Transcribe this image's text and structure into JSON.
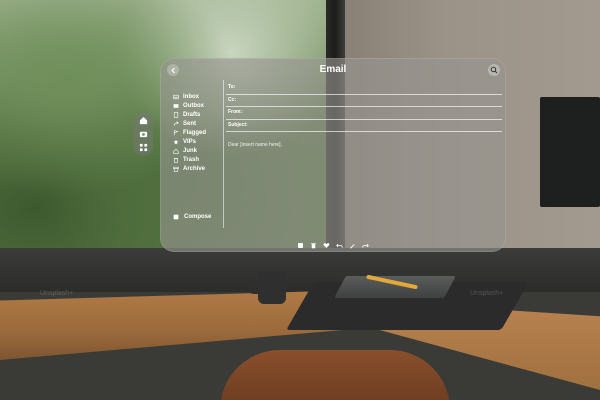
{
  "window": {
    "title": "Email"
  },
  "rail": {
    "icons": [
      "home-icon",
      "camera-icon",
      "grid-icon"
    ]
  },
  "sidebar": {
    "items": [
      {
        "label": "Inbox",
        "icon": "inbox-icon"
      },
      {
        "label": "Outbox",
        "icon": "outbox-icon"
      },
      {
        "label": "Drafts",
        "icon": "drafts-icon"
      },
      {
        "label": "Sent",
        "icon": "sent-icon"
      },
      {
        "label": "Flagged",
        "icon": "flag-icon"
      },
      {
        "label": "VIPs",
        "icon": "star-icon"
      },
      {
        "label": "Junk",
        "icon": "junk-icon"
      },
      {
        "label": "Trash",
        "icon": "trash-icon"
      },
      {
        "label": "Archive",
        "icon": "archive-icon"
      }
    ],
    "compose_label": "Compose"
  },
  "compose_form": {
    "to_label": "To:",
    "cc_label": "Cc:",
    "from_label": "From:",
    "subject_label": "Subject:",
    "to_value": "",
    "cc_value": "",
    "from_value": "",
    "subject_value": "",
    "body": "Dear [insert name here],"
  },
  "toolbar": {
    "icons": [
      "attach-icon",
      "trash-icon",
      "heart-icon",
      "undo-icon",
      "draw-icon",
      "forward-icon"
    ]
  },
  "watermark": "Unsplash+",
  "colors": {
    "panel": "#969490",
    "text": "#ffffff"
  }
}
